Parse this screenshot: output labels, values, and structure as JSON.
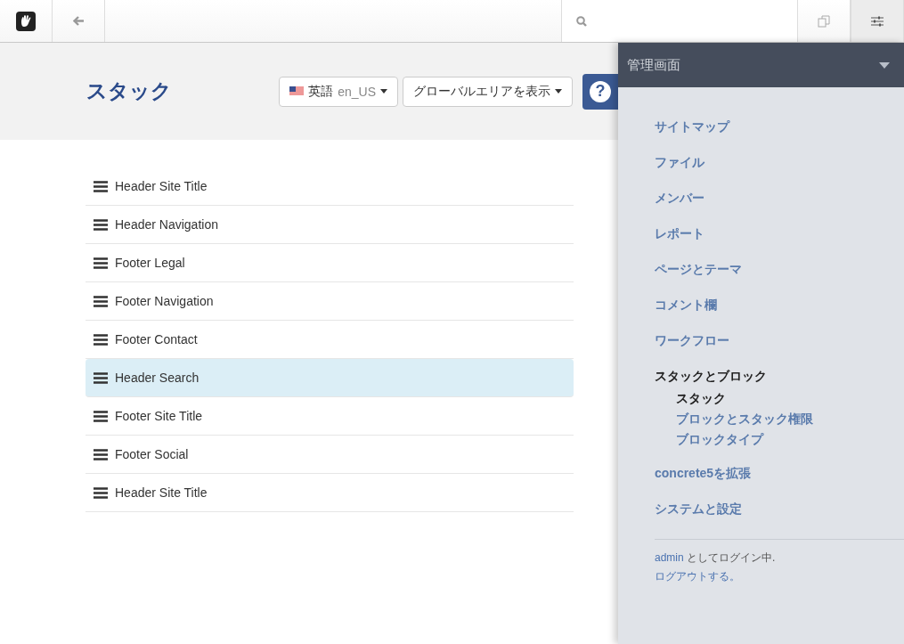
{
  "page_title": "スタック",
  "language_button": {
    "label": "英語",
    "locale": "en_US"
  },
  "global_area_button": {
    "label": "グローバルエリアを表示"
  },
  "help_button": {
    "label": "?"
  },
  "stacks": [
    {
      "name": "Header Site Title",
      "selected": false
    },
    {
      "name": "Header Navigation",
      "selected": false
    },
    {
      "name": "Footer Legal",
      "selected": false
    },
    {
      "name": "Footer Navigation",
      "selected": false
    },
    {
      "name": "Footer Contact",
      "selected": false
    },
    {
      "name": "Header Search",
      "selected": true
    },
    {
      "name": "Footer Site Title",
      "selected": false
    },
    {
      "name": "Footer Social",
      "selected": false
    },
    {
      "name": "Header Site Title",
      "selected": false
    }
  ],
  "sidebar": {
    "title": "管理画面",
    "items": [
      {
        "label": "サイトマップ",
        "selected": false
      },
      {
        "label": "ファイル",
        "selected": false
      },
      {
        "label": "メンバー",
        "selected": false
      },
      {
        "label": "レポート",
        "selected": false
      },
      {
        "label": "ページとテーマ",
        "selected": false
      },
      {
        "label": "コメント欄",
        "selected": false
      },
      {
        "label": "ワークフロー",
        "selected": false
      },
      {
        "label": "スタックとブロック",
        "selected": true,
        "children": [
          {
            "label": "スタック",
            "selected": true
          },
          {
            "label": "ブロックとスタック権限",
            "selected": false
          },
          {
            "label": "ブロックタイプ",
            "selected": false
          }
        ]
      },
      {
        "label": "concrete5を拡張",
        "selected": false
      },
      {
        "label": "システムと設定",
        "selected": false
      }
    ],
    "user": "admin",
    "login_text": "としてログイン中.",
    "logout": "ログアウトする。"
  }
}
